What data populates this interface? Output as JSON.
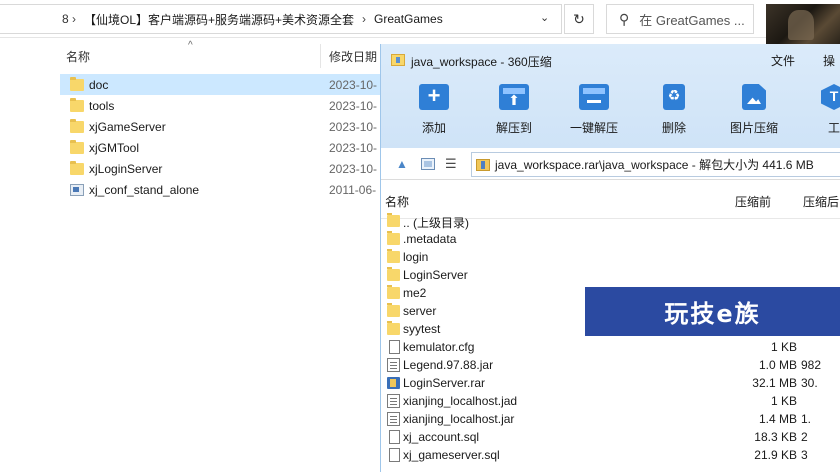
{
  "explorer": {
    "address": {
      "cut_prefix": "8",
      "path_parts": [
        "【仙境OL】客户端源码+服务端源码+美术资源全套",
        "GreatGames"
      ]
    },
    "search_placeholder": "在 GreatGames ...",
    "columns": {
      "name": "名称",
      "date": "修改日期"
    },
    "files": [
      {
        "name": "doc",
        "date": "2023-10-",
        "icon": "folder-icon",
        "selected": true
      },
      {
        "name": "tools",
        "date": "2023-10-",
        "icon": "folder-icon"
      },
      {
        "name": "xjGameServer",
        "date": "2023-10-",
        "icon": "folder-icon"
      },
      {
        "name": "xjGMTool",
        "date": "2023-10-",
        "icon": "folder-icon"
      },
      {
        "name": "xjLoginServer",
        "date": "2023-10-",
        "icon": "folder-icon"
      },
      {
        "name": "xj_conf_stand_alone",
        "date": "2011-06-",
        "icon": "config-file-icon"
      }
    ]
  },
  "zip": {
    "title": "java_workspace - 360压缩",
    "menu": [
      "文件",
      "操"
    ],
    "toolbar": [
      {
        "label": "添加",
        "icon": "add-icon"
      },
      {
        "label": "解压到",
        "icon": "extract-to-icon"
      },
      {
        "label": "一键解压",
        "icon": "one-click-extract-icon"
      },
      {
        "label": "删除",
        "icon": "delete-icon"
      },
      {
        "label": "图片压缩",
        "icon": "image-compress-icon"
      },
      {
        "label": "工",
        "icon": "tools-icon"
      }
    ],
    "path": "java_workspace.rar\\java_workspace - 解包大小为 441.6 MB",
    "columns": {
      "name": "名称",
      "before": "压缩前",
      "after": "压缩后"
    },
    "items": [
      {
        "name": ".. (上级目录)",
        "size": "",
        "comp": "",
        "icon": "folder"
      },
      {
        "name": ".metadata",
        "size": "",
        "comp": "",
        "icon": "folder"
      },
      {
        "name": "login",
        "size": "",
        "comp": "",
        "icon": "folder"
      },
      {
        "name": "LoginServer",
        "size": "",
        "comp": "",
        "icon": "folder"
      },
      {
        "name": "me2",
        "size": "",
        "comp": "",
        "icon": "folder"
      },
      {
        "name": "server",
        "size": "",
        "comp": "",
        "icon": "folder"
      },
      {
        "name": "syytest",
        "size": "",
        "comp": "",
        "icon": "folder"
      },
      {
        "name": "kemulator.cfg",
        "size": "1 KB",
        "comp": "",
        "icon": "file"
      },
      {
        "name": "Legend.97.88.jar",
        "size": "1.0 MB",
        "comp": "982",
        "icon": "jar"
      },
      {
        "name": "LoginServer.rar",
        "size": "32.1 MB",
        "comp": "30.",
        "icon": "rar"
      },
      {
        "name": "xianjing_localhost.jad",
        "size": "1 KB",
        "comp": "",
        "icon": "jar"
      },
      {
        "name": "xianjing_localhost.jar",
        "size": "1.4 MB",
        "comp": "1.",
        "icon": "jar"
      },
      {
        "name": "xj_account.sql",
        "size": "18.3 KB",
        "comp": "2",
        "icon": "file"
      },
      {
        "name": "xj_gameserver.sql",
        "size": "21.9 KB",
        "comp": "3",
        "icon": "file"
      }
    ]
  },
  "watermark": "玩技e族"
}
